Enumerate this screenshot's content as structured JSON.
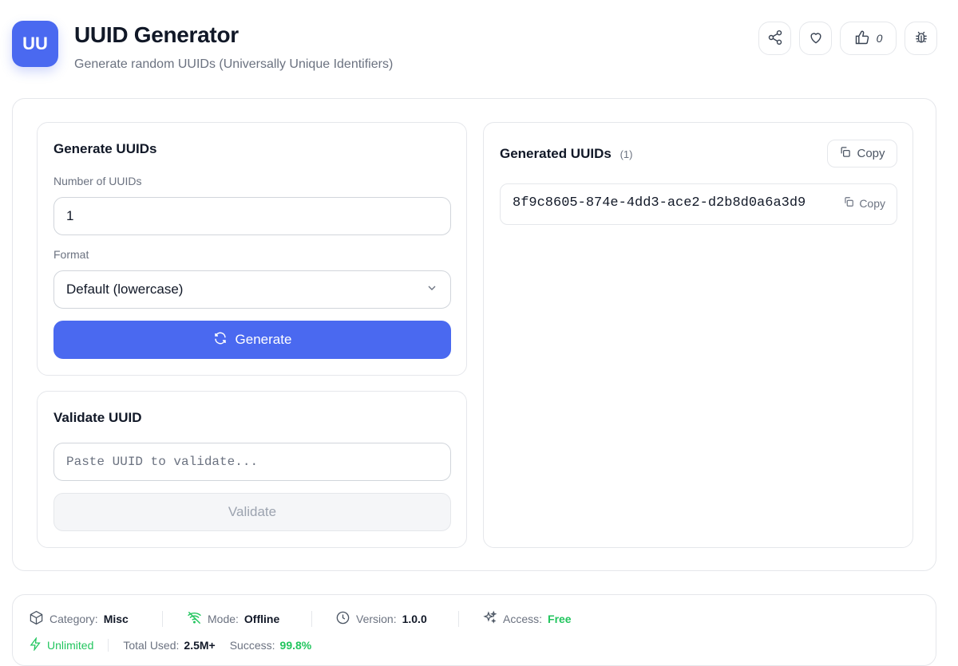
{
  "header": {
    "logo_text": "UU",
    "title": "UUID Generator",
    "subtitle": "Generate random UUIDs (Universally Unique Identifiers)",
    "like_count": "0",
    "icons": [
      "share-icon",
      "heart-icon",
      "thumbs-up-icon",
      "bug-icon"
    ]
  },
  "generate": {
    "title": "Generate UUIDs",
    "count_label": "Number of UUIDs",
    "count_value": "1",
    "format_label": "Format",
    "format_value": "Default (lowercase)",
    "button_label": "Generate"
  },
  "validate": {
    "title": "Validate UUID",
    "placeholder": "Paste UUID to validate...",
    "button_label": "Validate"
  },
  "results": {
    "title": "Generated UUIDs",
    "count": "(1)",
    "copy_all_label": "Copy",
    "items": [
      {
        "value": "8f9c8605-874e-4dd3-ace2-d2b8d0a6a3d9",
        "copy_label": "Copy"
      }
    ]
  },
  "footer": {
    "category_label": "Category:",
    "category_value": "Misc",
    "mode_label": "Mode:",
    "mode_value": "Offline",
    "version_label": "Version:",
    "version_value": "1.0.0",
    "access_label": "Access:",
    "access_value": "Free",
    "unlimited_label": "Unlimited",
    "total_label": "Total Used:",
    "total_value": "2.5M+",
    "success_label": "Success:",
    "success_value": "99.8%"
  },
  "colors": {
    "accent": "#4a69f0",
    "success": "#22c55e"
  }
}
